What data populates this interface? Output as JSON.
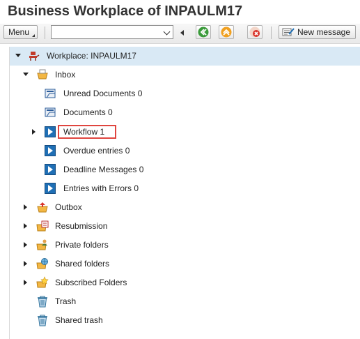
{
  "window": {
    "title": "Business Workplace of INPAULM17"
  },
  "toolbar": {
    "menu_label": "Menu",
    "command_field_value": "",
    "buttons": [
      {
        "name": "back",
        "icon": "back-icon"
      },
      {
        "name": "exit",
        "icon": "exit-icon"
      },
      {
        "name": "cancel",
        "icon": "cancel-icon"
      }
    ],
    "new_message_label": "New message"
  },
  "tree": {
    "root": {
      "label": "Workplace: INPAULM17",
      "icon": "workplace-icon"
    },
    "inbox": {
      "label": "Inbox",
      "icon": "inbox-icon",
      "children": [
        {
          "label": "Unread Documents 0",
          "icon": "documents-icon"
        },
        {
          "label": "Documents 0",
          "icon": "documents-icon"
        },
        {
          "label": "Workflow 1",
          "icon": "workflow-icon"
        },
        {
          "label": "Overdue entries 0",
          "icon": "workflow-icon"
        },
        {
          "label": "Deadline Messages 0",
          "icon": "workflow-icon"
        },
        {
          "label": "Entries with Errors 0",
          "icon": "workflow-icon"
        }
      ]
    },
    "folders": [
      {
        "label": "Outbox",
        "icon": "outbox-icon"
      },
      {
        "label": "Resubmission",
        "icon": "resubmission-icon"
      },
      {
        "label": "Private folders",
        "icon": "private-folders-icon"
      },
      {
        "label": "Shared folders",
        "icon": "shared-folders-icon"
      },
      {
        "label": "Subscribed Folders",
        "icon": "subscribed-folders-icon"
      },
      {
        "label": "Trash",
        "icon": "trash-icon"
      },
      {
        "label": "Shared trash",
        "icon": "trash-icon"
      }
    ]
  },
  "colors": {
    "selection": "#d9e9f5",
    "highlight_box": "#e0453f",
    "accent": "#1f6fb5"
  }
}
